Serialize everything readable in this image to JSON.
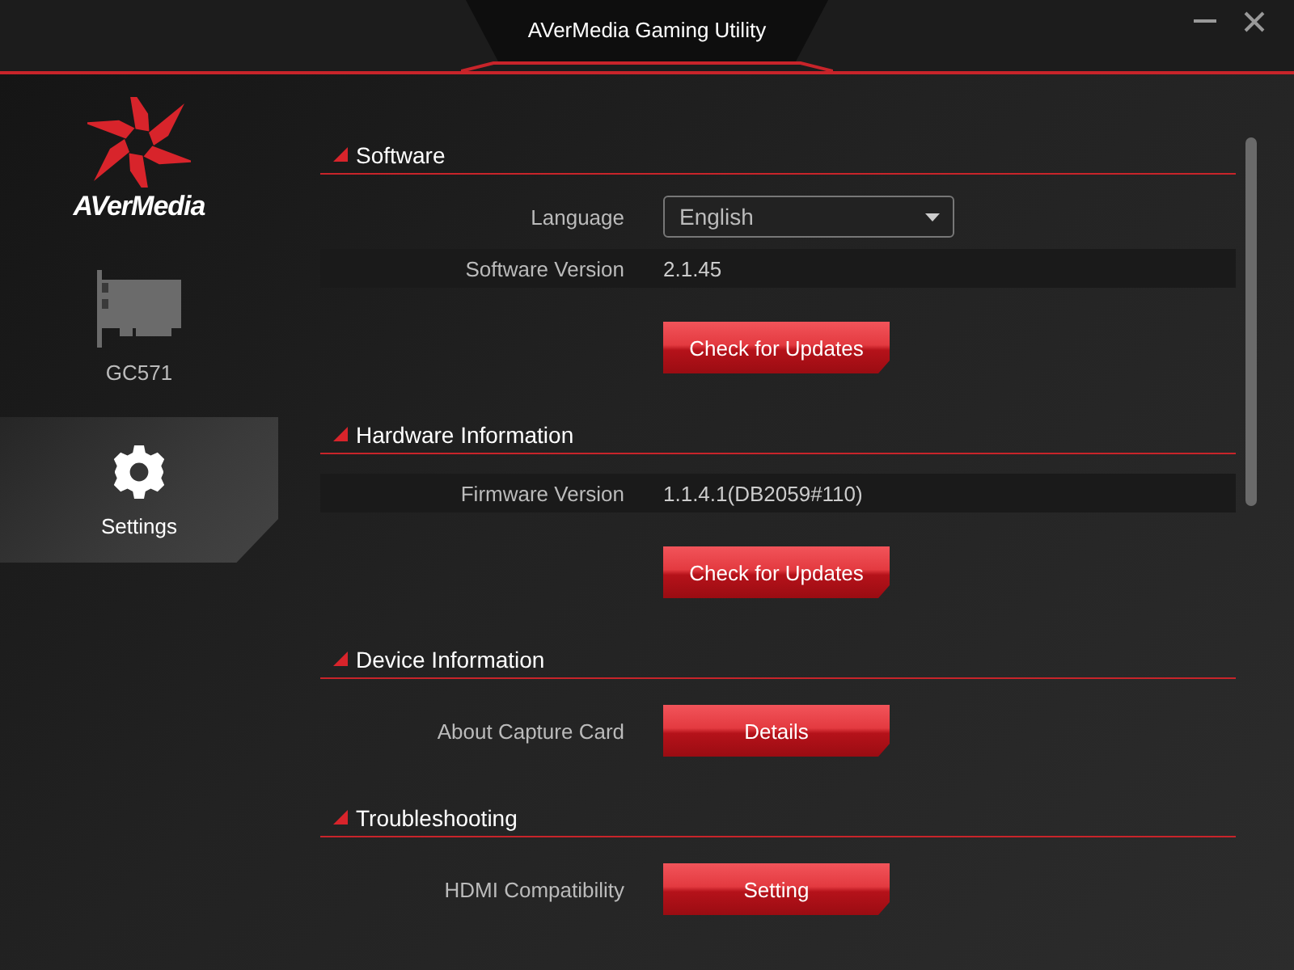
{
  "window": {
    "title": "AVerMedia Gaming Utility"
  },
  "sidebar": {
    "logo": "AVerMedia",
    "items": [
      {
        "label": "GC571",
        "kind": "device",
        "selected": false
      },
      {
        "label": "Settings",
        "kind": "settings",
        "selected": true
      }
    ]
  },
  "sections": [
    {
      "title": "Software",
      "rows": [
        {
          "kind": "dropdown",
          "label": "Language",
          "value": "English"
        },
        {
          "kind": "value",
          "label": "Software Version",
          "value": "2.1.45"
        },
        {
          "kind": "button",
          "button": "Check for Updates"
        }
      ]
    },
    {
      "title": "Hardware Information",
      "rows": [
        {
          "kind": "value",
          "label": "Firmware Version",
          "value": "1.1.4.1(DB2059#110)"
        },
        {
          "kind": "button",
          "button": "Check for Updates"
        }
      ]
    },
    {
      "title": "Device Information",
      "rows": [
        {
          "kind": "button",
          "label": "About Capture Card",
          "button": "Details"
        }
      ]
    },
    {
      "title": "Troubleshooting",
      "rows": [
        {
          "kind": "button",
          "label": "HDMI Compatibility",
          "button": "Setting"
        }
      ]
    }
  ]
}
